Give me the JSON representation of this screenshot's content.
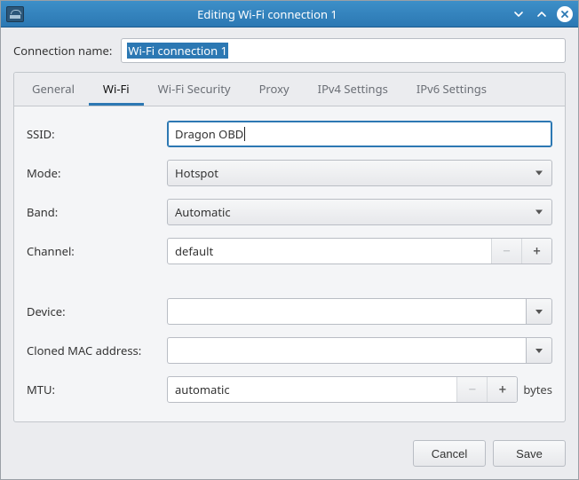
{
  "titlebar": {
    "title": "Editing Wi-Fi connection 1"
  },
  "conn_name_label": "Connection name:",
  "conn_name_value": "Wi-Fi connection 1",
  "tabs": {
    "general": "General",
    "wifi": "Wi-Fi",
    "wifisec": "Wi-Fi Security",
    "proxy": "Proxy",
    "ipv4": "IPv4 Settings",
    "ipv6": "IPv6 Settings"
  },
  "wifi": {
    "ssid_label": "SSID:",
    "ssid_value": "Dragon OBD",
    "mode_label": "Mode:",
    "mode_value": "Hotspot",
    "band_label": "Band:",
    "band_value": "Automatic",
    "channel_label": "Channel:",
    "channel_value": "default",
    "device_label": "Device:",
    "device_value": "",
    "cloned_label": "Cloned MAC address:",
    "cloned_value": "",
    "mtu_label": "MTU:",
    "mtu_value": "automatic",
    "mtu_unit": "bytes",
    "minus": "−",
    "plus": "+"
  },
  "footer": {
    "cancel": "Cancel",
    "save": "Save"
  }
}
